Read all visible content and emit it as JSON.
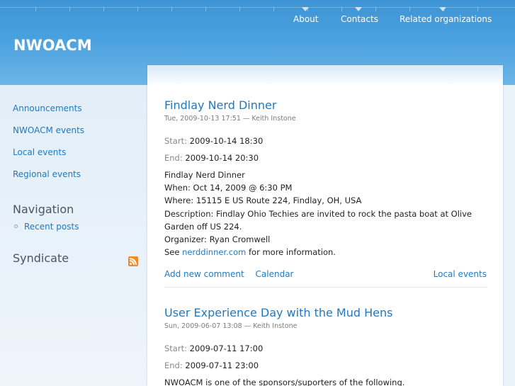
{
  "site": {
    "name": "NWOACM"
  },
  "primary_nav": [
    {
      "label": "About"
    },
    {
      "label": "Contacts"
    },
    {
      "label": "Related organizations"
    }
  ],
  "sidebar": {
    "links": [
      {
        "label": "Announcements"
      },
      {
        "label": "NWOACM events"
      },
      {
        "label": "Local events"
      },
      {
        "label": "Regional events"
      }
    ],
    "navigation": {
      "title": "Navigation",
      "items": [
        {
          "label": "Recent posts"
        }
      ]
    },
    "syndicate": {
      "title": "Syndicate",
      "icon": "rss-feed-icon"
    }
  },
  "nodes": [
    {
      "title": "Findlay Nerd Dinner",
      "meta": "Tue, 2009-10-13 17:51 — Keith Instone",
      "start_label": "Start:",
      "start": "2009-10-14 18:30",
      "end_label": "End:",
      "end": "2009-10-14 20:30",
      "body": [
        "Findlay Nerd Dinner",
        "When: Oct 14, 2009 @ 6:30 PM",
        "Where: 15115 E US Route 224, Findlay, OH, USA",
        "Description: Findlay Ohio Techies are invited to rock the pasta boat at Olive",
        "Garden off US 224.",
        "Organizer: Ryan Cromwell"
      ],
      "see_prefix": "See ",
      "see_link": "nerddinner.com",
      "see_suffix": " for more information.",
      "links": {
        "add_comment": "Add new comment",
        "calendar": "Calendar",
        "category": "Local events"
      }
    },
    {
      "title": "User Experience Day with the Mud Hens",
      "meta": "Sun, 2009-06-07 13:08 — Keith Instone",
      "start_label": "Start:",
      "start": "2009-07-11 17:00",
      "end_label": "End:",
      "end": "2009-07-11 23:00",
      "body": [
        "NWOACM is one of the sponsors/suporters of the following."
      ]
    }
  ]
}
